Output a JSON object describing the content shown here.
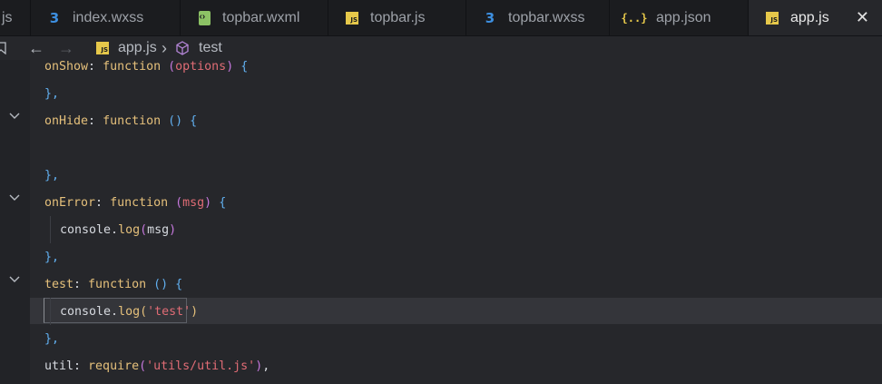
{
  "tabs": [
    {
      "label": "js",
      "icon": "none"
    },
    {
      "label": "index.wxss",
      "icon": "css-icon"
    },
    {
      "label": "topbar.wxml",
      "icon": "xml-icon"
    },
    {
      "label": "topbar.js",
      "icon": "js-icon"
    },
    {
      "label": "topbar.wxss",
      "icon": "css-icon"
    },
    {
      "label": "app.json",
      "icon": "json-icon"
    },
    {
      "label": "app.js",
      "icon": "js-icon",
      "active": true
    }
  ],
  "close_symbol": "✕",
  "nav": {
    "back": "←",
    "forward": "→",
    "file": "app.js",
    "sep": "›",
    "symbol": "test"
  },
  "icons": {
    "js_badge": "JS",
    "css_glyph": "3",
    "json_glyph": "{..}"
  },
  "code": {
    "l1": {
      "name": "onShow",
      "colon": ": ",
      "kw": "function",
      "sp": " ",
      "open": "(",
      "param": "options",
      "close": ")",
      "brace": " {"
    },
    "l2": {
      "text": "},"
    },
    "l3": {
      "name": "onHide",
      "colon": ": ",
      "kw": "function",
      "rest": " () {"
    },
    "l5": {
      "text": "},"
    },
    "l6": {
      "name": "onError",
      "colon": ": ",
      "kw": "function",
      "sp": " ",
      "open": "(",
      "param": "msg",
      "close": ")",
      "brace": " {"
    },
    "l7": {
      "obj": "console",
      "dot": ".",
      "method": "log",
      "open": "(",
      "arg": "msg",
      "close": ")"
    },
    "l8": {
      "text": "},"
    },
    "l9": {
      "name": "test",
      "colon": ": ",
      "kw": "function",
      "rest": " () {"
    },
    "l10": {
      "obj": "console",
      "dot": ".",
      "method": "log",
      "open": "(",
      "arg": "'test'",
      "close": ")"
    },
    "l11": {
      "text": "},"
    },
    "l12": {
      "name": "util",
      "colon": ": ",
      "call": "require",
      "open": "(",
      "arg": "'utils/util.js'",
      "close": ")",
      "end": ","
    }
  },
  "colors": {
    "accent_yellow": "#e5c07b",
    "keyword": "#c678dd",
    "string": "#e06c75",
    "bracket": "#61afef"
  }
}
